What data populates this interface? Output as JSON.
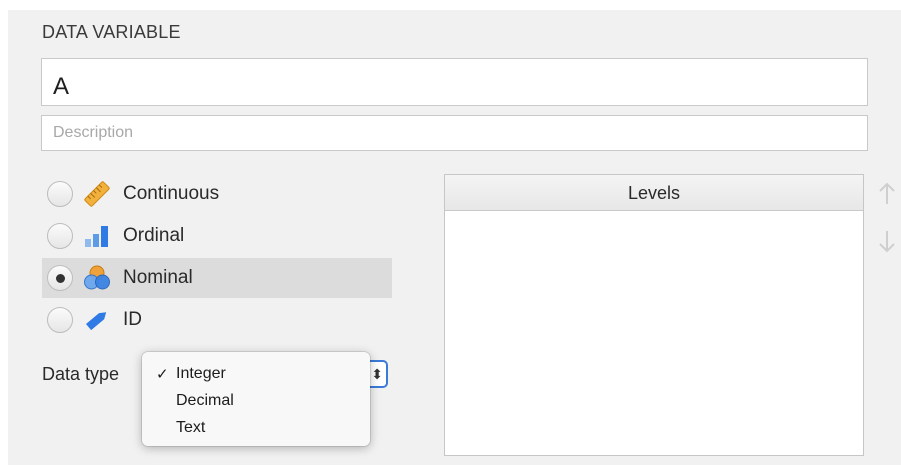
{
  "section_title": "DATA VARIABLE",
  "name_field": {
    "value": "A"
  },
  "description_field": {
    "placeholder": "Description"
  },
  "measure_types": [
    {
      "label": "Continuous",
      "icon": "ruler-icon",
      "selected": false
    },
    {
      "label": "Ordinal",
      "icon": "bar-chart-icon",
      "selected": false
    },
    {
      "label": "Nominal",
      "icon": "venn-circles-icon",
      "selected": true
    },
    {
      "label": "ID",
      "icon": "tag-pencil-icon",
      "selected": false
    }
  ],
  "data_type": {
    "label": "Data type",
    "selected": "Integer",
    "options": [
      "Integer",
      "Decimal",
      "Text"
    ],
    "check_glyph": "✓"
  },
  "levels": {
    "header": "Levels",
    "items": []
  },
  "colors": {
    "accent": "#3b7bd8",
    "ruler": "#f2b13c",
    "ordinal": "#2f7ae5",
    "nominal_orange": "#f0a23a",
    "nominal_blue": "#3a83e3"
  }
}
